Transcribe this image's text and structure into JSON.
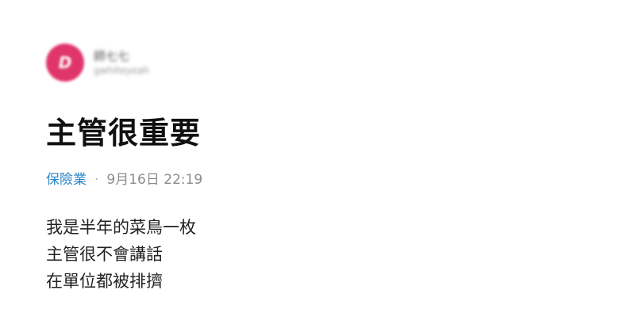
{
  "author": {
    "avatar_letter": "D",
    "name": "師七七",
    "handle": "gwhiteyeah"
  },
  "post": {
    "title": "主管很重要",
    "board": "保險業",
    "separator": "·",
    "timestamp": "9月16日 22:19",
    "body_lines": [
      "我是半年的菜鳥一枚",
      "主管很不會講話",
      "在單位都被排擠"
    ]
  },
  "colors": {
    "avatar_bg": "#e0356c",
    "board_link": "#2a87c7",
    "meta_text": "#8c8c8c"
  }
}
